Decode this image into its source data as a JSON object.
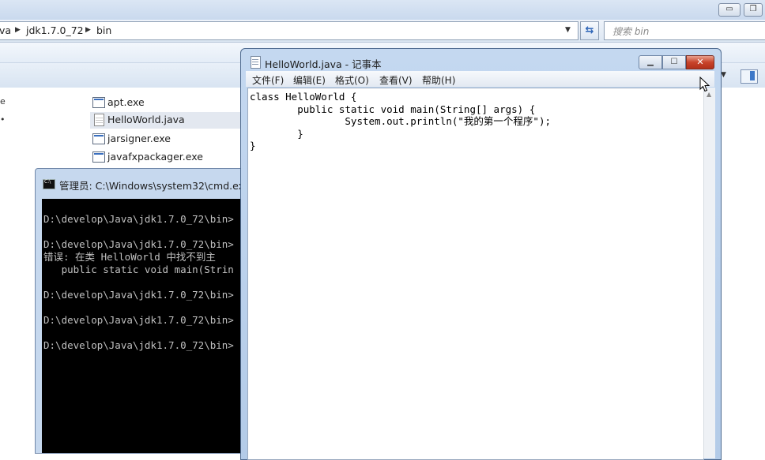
{
  "explorer": {
    "breadcrumbs": [
      "va",
      "jdk1.7.0_72",
      "bin"
    ],
    "search_placeholder": "搜索 bin",
    "files": [
      {
        "name": "apt.exe",
        "icon": "exe-icon"
      },
      {
        "name": "HelloWorld.java",
        "icon": "java-file-icon",
        "selected": true
      },
      {
        "name": "jarsigner.exe",
        "icon": "exe-icon"
      },
      {
        "name": "javafxpackager.exe",
        "icon": "exe-icon"
      }
    ],
    "left_fragments": [
      "e",
      "•"
    ]
  },
  "cmd": {
    "title": "管理员: C:\\Windows\\system32\\cmd.exe",
    "lines": [
      "D:\\develop\\Java\\jdk1.7.0_72\\bin>",
      "",
      "D:\\develop\\Java\\jdk1.7.0_72\\bin>",
      "错误: 在类 HelloWorld 中找不到主",
      "   public static void main(Strin",
      "",
      "D:\\develop\\Java\\jdk1.7.0_72\\bin>",
      "",
      "D:\\develop\\Java\\jdk1.7.0_72\\bin>",
      "",
      "D:\\develop\\Java\\jdk1.7.0_72\\bin>"
    ]
  },
  "notepad": {
    "title": "HelloWorld.java - 记事本",
    "menu": [
      "文件(F)",
      "编辑(E)",
      "格式(O)",
      "查看(V)",
      "帮助(H)"
    ],
    "code": "class HelloWorld {\n        public static void main(String[] args) {\n                System.out.println(\"我的第一个程序\");\n        }\n}"
  },
  "colors": {
    "console_bg": "#000000",
    "console_text": "#c0c0c0",
    "close_button": "#c8432a",
    "window_frame": "#c4d8f0"
  }
}
